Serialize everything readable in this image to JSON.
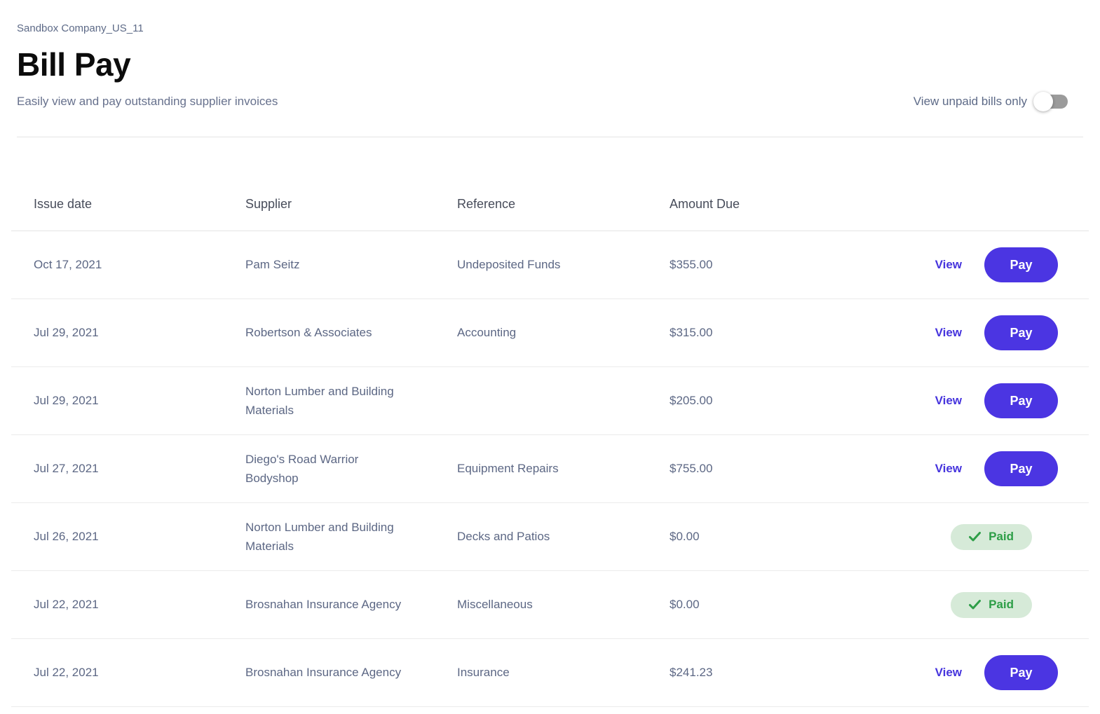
{
  "page": {
    "company": "Sandbox Company_US_11",
    "title": "Bill Pay",
    "subtitle": "Easily view and pay outstanding supplier invoices",
    "toggle": {
      "label": "View unpaid bills only",
      "state": "off"
    }
  },
  "table": {
    "columns": [
      "Issue date",
      "Supplier",
      "Reference",
      "Amount Due"
    ],
    "view_label": "View",
    "pay_label": "Pay",
    "paid_label": "Paid",
    "rows": [
      {
        "issue_date": "Oct 17, 2021",
        "supplier": "Pam Seitz",
        "reference": "Undeposited Funds",
        "amount_due": "$355.00",
        "status": "unpaid"
      },
      {
        "issue_date": "Jul 29, 2021",
        "supplier": "Robertson & Associates",
        "reference": "Accounting",
        "amount_due": "$315.00",
        "status": "unpaid"
      },
      {
        "issue_date": "Jul 29, 2021",
        "supplier": "Norton Lumber and Building Materials",
        "reference": "",
        "amount_due": "$205.00",
        "status": "unpaid"
      },
      {
        "issue_date": "Jul 27, 2021",
        "supplier": "Diego's Road Warrior Bodyshop",
        "reference": "Equipment Repairs",
        "amount_due": "$755.00",
        "status": "unpaid"
      },
      {
        "issue_date": "Jul 26, 2021",
        "supplier": "Norton Lumber and Building Materials",
        "reference": "Decks and Patios",
        "amount_due": "$0.00",
        "status": "paid"
      },
      {
        "issue_date": "Jul 22, 2021",
        "supplier": "Brosnahan Insurance Agency",
        "reference": "Miscellaneous",
        "amount_due": "$0.00",
        "status": "paid"
      },
      {
        "issue_date": "Jul 22, 2021",
        "supplier": "Brosnahan Insurance Agency",
        "reference": "Insurance",
        "amount_due": "$241.23",
        "status": "unpaid"
      }
    ]
  },
  "colors": {
    "accent_purple": "#4B35E2",
    "view_link_purple": "#4634DD",
    "paid_green": "#2D9E47",
    "paid_badge_bg": "#D6EAD8",
    "toggle_track_gray": "#9B9B9B"
  }
}
